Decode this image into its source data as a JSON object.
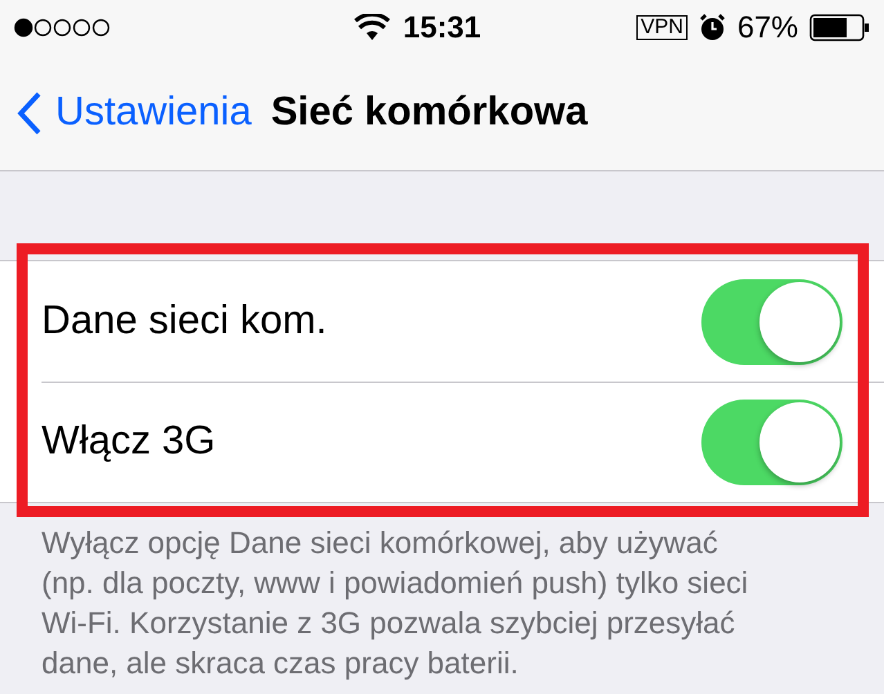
{
  "status_bar": {
    "time": "15:31",
    "vpn": "VPN",
    "battery": "67%"
  },
  "nav": {
    "back": "Ustawienia",
    "title": "Sieć komórkowa"
  },
  "rows": [
    {
      "label": "Dane sieci kom.",
      "on": true
    },
    {
      "label": "Włącz 3G",
      "on": true
    }
  ],
  "footer": "Wyłącz opcję Dane sieci komórkowej, aby używać (np. dla poczty, www i powiadomień push) tylko sieci Wi-Fi. Korzystanie z 3G pozwala szybciej przesyłać dane, ale skraca czas pracy baterii."
}
